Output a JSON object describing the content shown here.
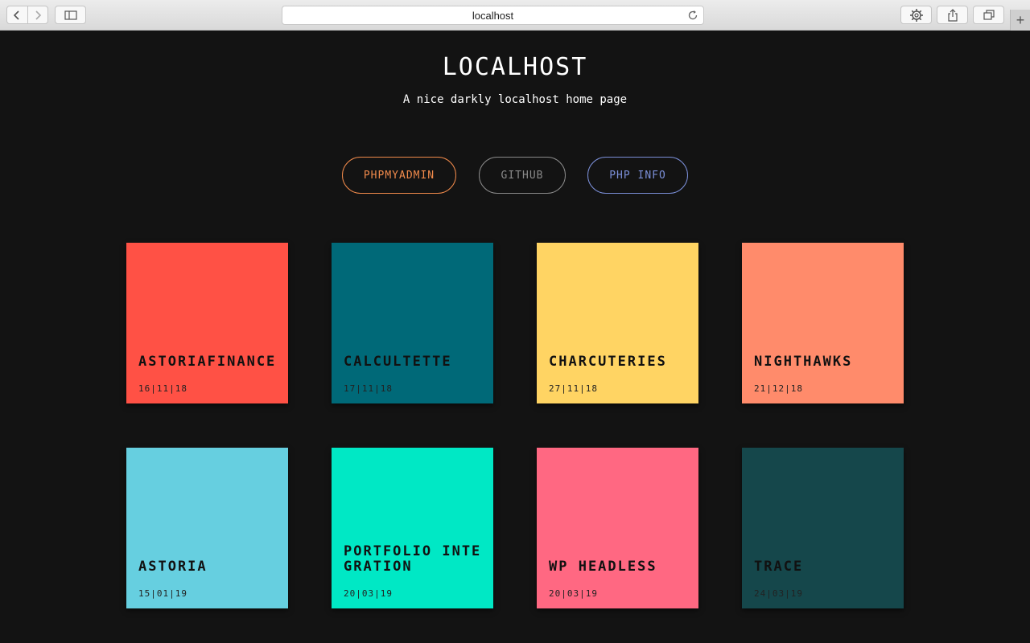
{
  "browser": {
    "url": "localhost",
    "new_tab_label": "+"
  },
  "header": {
    "title": "LOCALHOST",
    "subtitle": "A nice darkly localhost home page"
  },
  "links": [
    {
      "label": "PHPMYADMIN",
      "color": "#f08a4b"
    },
    {
      "label": "GITHUB",
      "color": "#8a8a8a"
    },
    {
      "label": "PHP INFO",
      "color": "#7b8fd8"
    }
  ],
  "projects": [
    {
      "name": "ASTORIAFINANCE",
      "date": "16|11|18",
      "color": "#ff5145"
    },
    {
      "name": "CALCULTETTE",
      "date": "17|11|18",
      "color": "#006978"
    },
    {
      "name": "CHARCUTERIES",
      "date": "27|11|18",
      "color": "#ffd463"
    },
    {
      "name": "NIGHTHAWKS",
      "date": "21|12|18",
      "color": "#ff8b6b"
    },
    {
      "name": "ASTORIA",
      "date": "15|01|19",
      "color": "#66cfe0"
    },
    {
      "name": "PORTFOLIO INTEGRATION",
      "date": "20|03|19",
      "color": "#00e8c5"
    },
    {
      "name": "WP HEADLESS",
      "date": "20|03|19",
      "color": "#ff6882"
    },
    {
      "name": "TRACE",
      "date": "24|03|19",
      "color": "#15474b"
    }
  ]
}
